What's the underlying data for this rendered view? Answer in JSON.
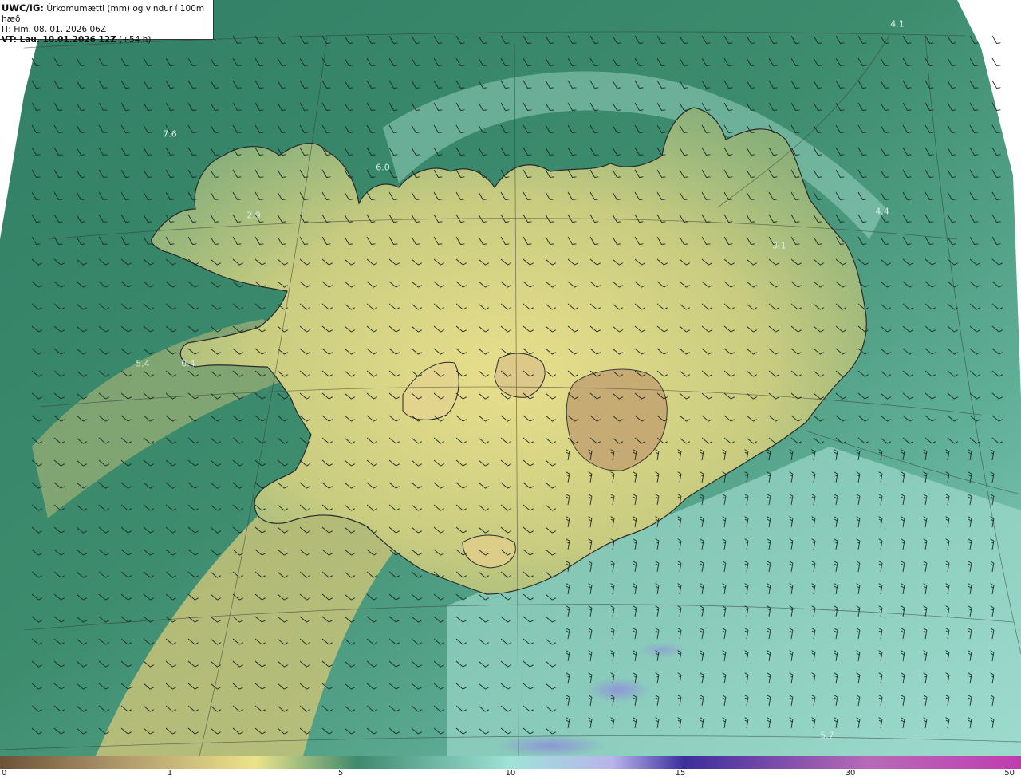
{
  "header": {
    "line1_bold": "UWC/IG:",
    "line1_text": " Úrkomumætti (mm) og vindur í 100m hæð",
    "line2": "IT: Fim. 08. 01. 2026 06Z",
    "line3_bold": "VT: Lau. 10.01.2026 12Z",
    "line3_text": " (+54 h)"
  },
  "map_values": [
    {
      "id": "v1",
      "text": "4.1"
    },
    {
      "id": "v2",
      "text": "7.6"
    },
    {
      "id": "v3",
      "text": "6.0"
    },
    {
      "id": "v4",
      "text": "2.9"
    },
    {
      "id": "v5",
      "text": "3.1"
    },
    {
      "id": "v6",
      "text": "4.4"
    },
    {
      "id": "v7",
      "text": "5.4"
    },
    {
      "id": "v8",
      "text": "5.7"
    },
    {
      "id": "v9",
      "text": "0.4"
    }
  ],
  "colorbar": {
    "ticks": [
      "0",
      "1",
      "5",
      "10",
      "15",
      "30",
      "50"
    ],
    "colors": [
      "#6b5238",
      "#b09a6c",
      "#ece48a",
      "#3f8a6e",
      "#9fe2d8",
      "#b8b4ec",
      "#3c2e9c",
      "#b86ab8",
      "#c03cb0"
    ]
  },
  "colors": {
    "sea_dark": "#2f7a62",
    "sea_light": "#8fd0c0",
    "land": "#d9d482",
    "land_high": "#bfa16a",
    "coastline": "#2a2a2a"
  }
}
